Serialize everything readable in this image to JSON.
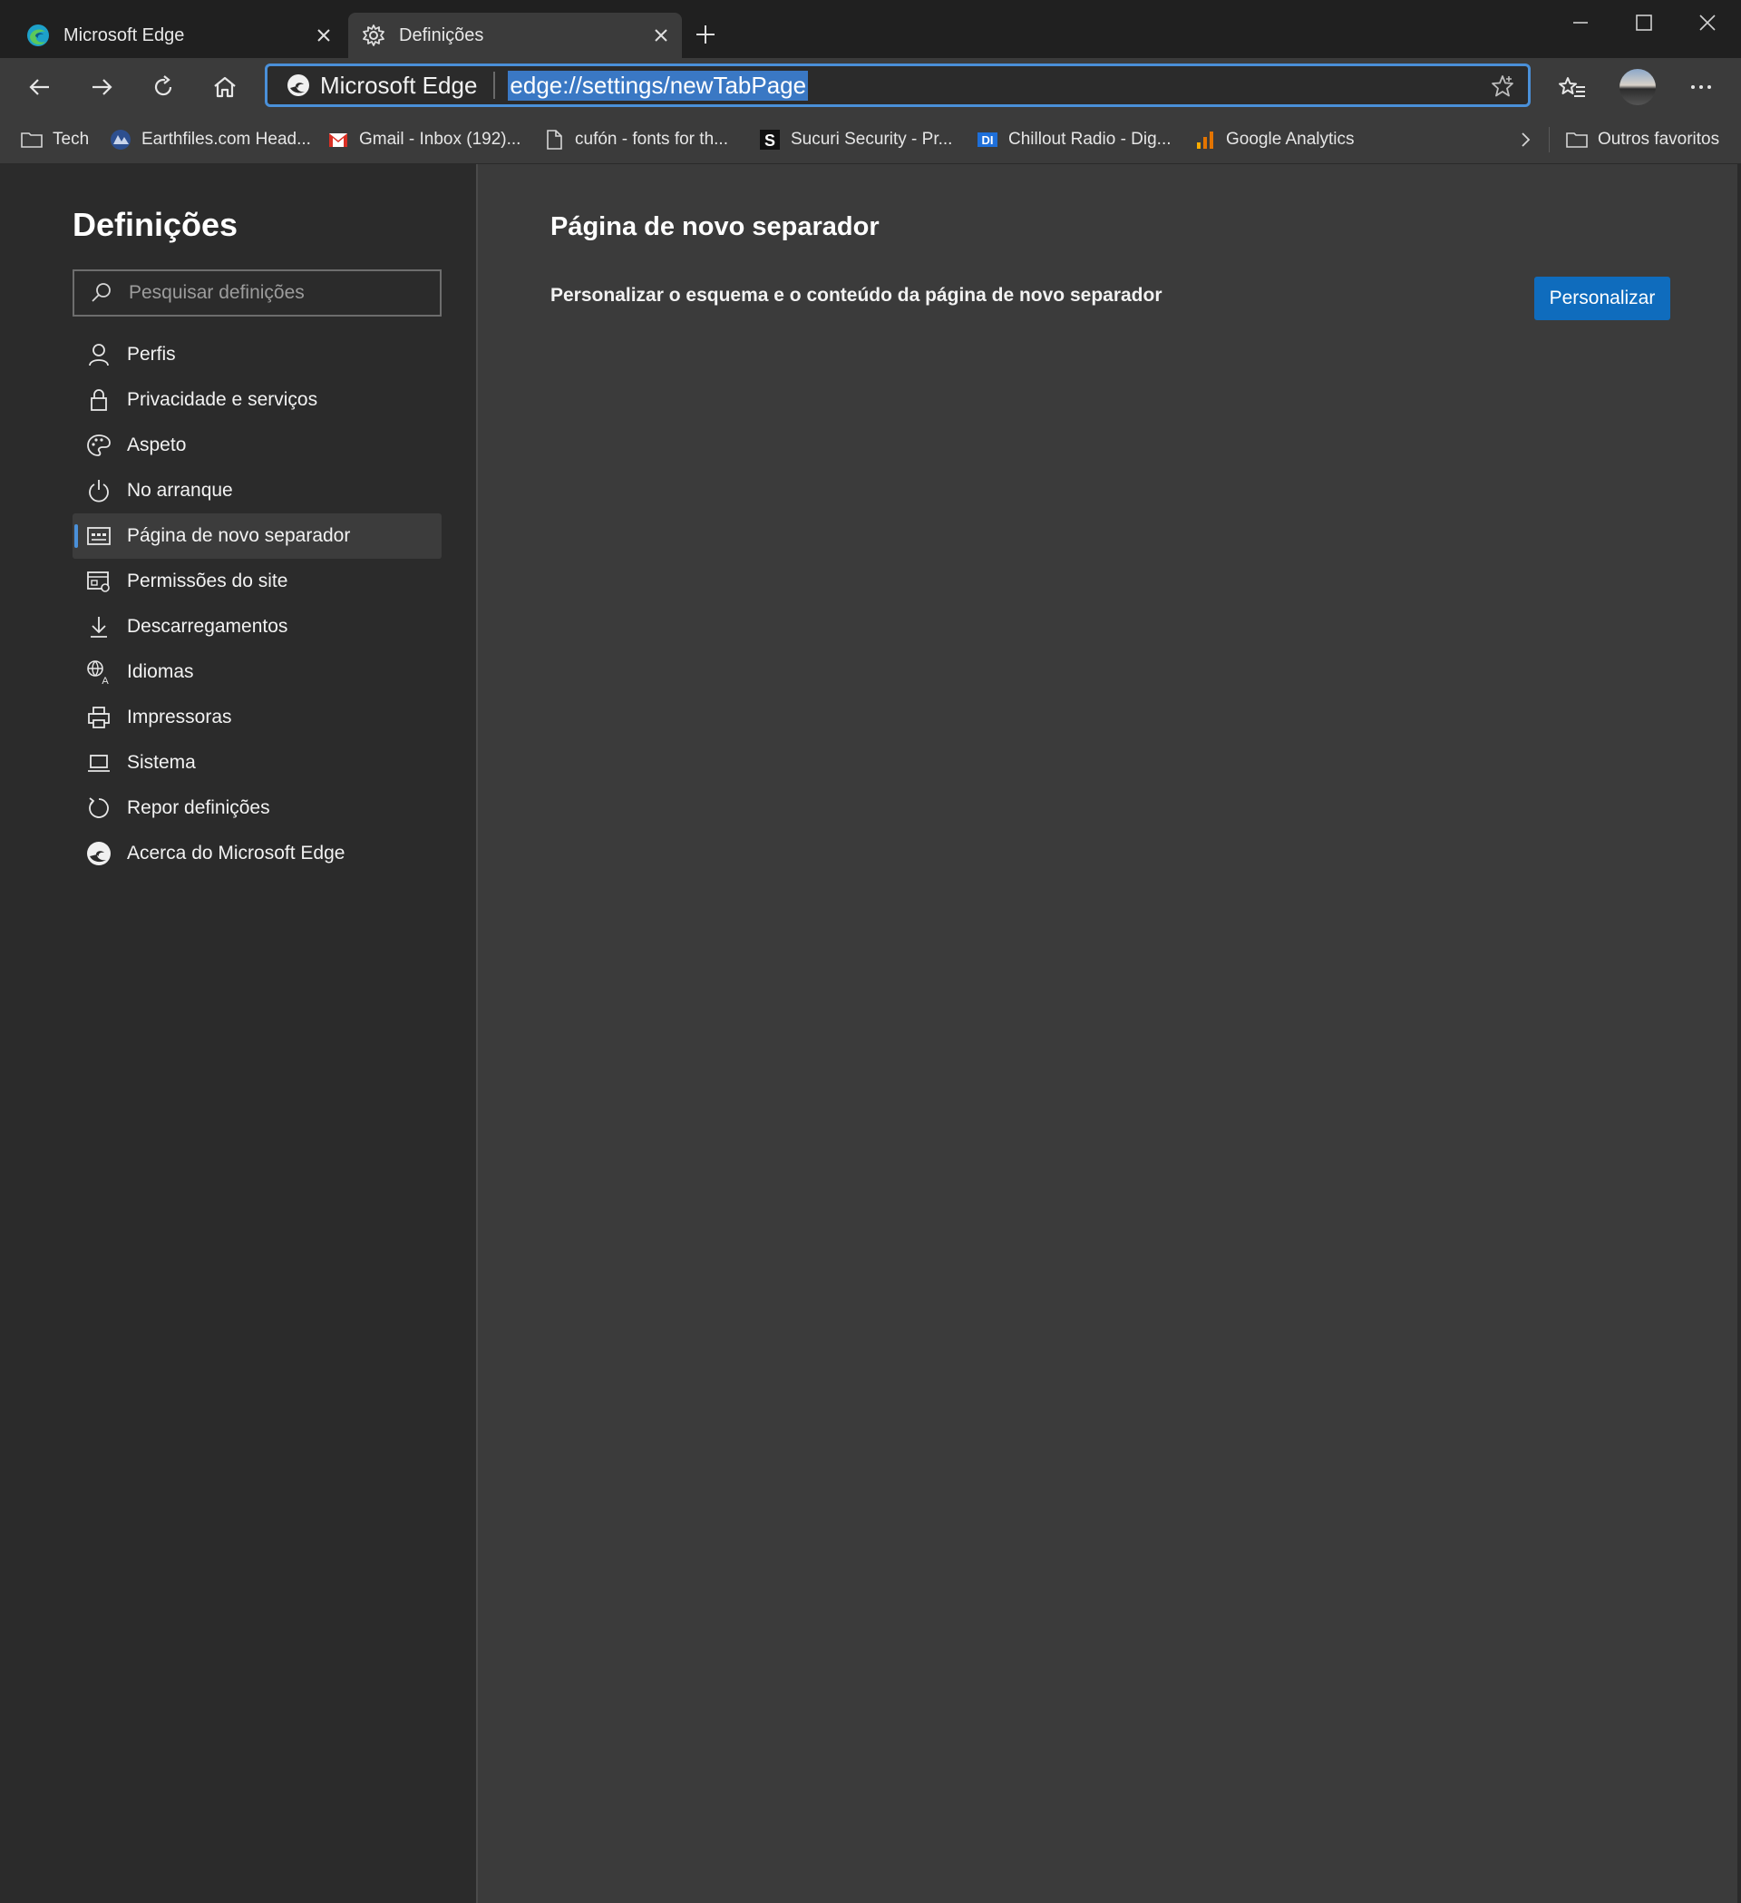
{
  "tabs": [
    {
      "title": "Microsoft Edge",
      "icon": "edge-logo-icon",
      "active": false
    },
    {
      "title": "Definições",
      "icon": "gear-icon",
      "active": true
    }
  ],
  "address_bar": {
    "site_name": "Microsoft Edge",
    "url": "edge://settings/newTabPage"
  },
  "bookmarks": [
    {
      "label": "Tech",
      "icon": "folder-icon"
    },
    {
      "label": "Earthfiles.com Head...",
      "icon": "earthfiles-icon"
    },
    {
      "label": "Gmail - Inbox (192)...",
      "icon": "gmail-icon"
    },
    {
      "label": "cufón - fonts for th...",
      "icon": "page-icon"
    },
    {
      "label": "Sucuri Security - Pr...",
      "icon": "sucuri-icon"
    },
    {
      "label": "Chillout Radio - Dig...",
      "icon": "di-icon"
    },
    {
      "label": "Google Analytics",
      "icon": "analytics-icon"
    }
  ],
  "other_favorites": "Outros favoritos",
  "sidebar": {
    "title": "Definições",
    "search_placeholder": "Pesquisar definições",
    "items": [
      {
        "label": "Perfis",
        "icon": "person-icon"
      },
      {
        "label": "Privacidade e serviços",
        "icon": "lock-icon"
      },
      {
        "label": "Aspeto",
        "icon": "palette-icon"
      },
      {
        "label": "No arranque",
        "icon": "power-icon"
      },
      {
        "label": "Página de novo separador",
        "icon": "new-tab-page-icon",
        "active": true
      },
      {
        "label": "Permissões do site",
        "icon": "site-permissions-icon"
      },
      {
        "label": "Descarregamentos",
        "icon": "download-icon"
      },
      {
        "label": "Idiomas",
        "icon": "languages-icon"
      },
      {
        "label": "Impressoras",
        "icon": "printer-icon"
      },
      {
        "label": "Sistema",
        "icon": "laptop-icon"
      },
      {
        "label": "Repor definições",
        "icon": "reset-icon"
      },
      {
        "label": "Acerca do Microsoft Edge",
        "icon": "edge-logo-icon"
      }
    ]
  },
  "main": {
    "title": "Página de novo separador",
    "description": "Personalizar o esquema e o conteúdo da página de novo separador",
    "button_label": "Personalizar"
  },
  "colors": {
    "accent": "#4a90d9",
    "button": "#0f6cbd",
    "sidebar_bg": "#2b2b2b",
    "content_bg": "#3b3b3b",
    "titlebar_bg": "#202020"
  }
}
